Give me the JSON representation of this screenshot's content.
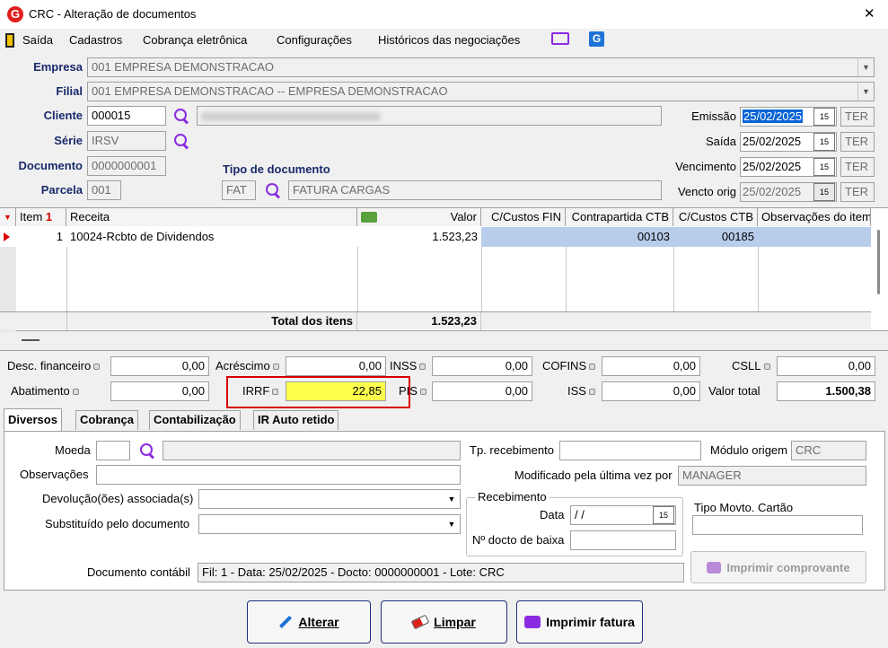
{
  "window": {
    "title": "CRC - Alteração de documentos",
    "close_label": "✕"
  },
  "menu": {
    "items": [
      "Saída",
      "Cadastros",
      "Cobrança eletrônica",
      "Configurações",
      "Históricos das negociações"
    ]
  },
  "header": {
    "empresa_label": "Empresa",
    "empresa_value": "001 EMPRESA DEMONSTRACAO",
    "filial_label": "Filial",
    "filial_value": "001 EMPRESA DEMONSTRACAO -- EMPRESA DEMONSTRACAO",
    "cliente_label": "Cliente",
    "cliente_value": "000015",
    "serie_label": "Série",
    "serie_value": "IRSV",
    "documento_label": "Documento",
    "documento_value": "0000000001",
    "parcela_label": "Parcela",
    "parcela_value": "001",
    "tipo_doc_label": "Tipo de documento",
    "tipo_doc_code": "FAT",
    "tipo_doc_desc": "FATURA CARGAS",
    "emissao_label": "Emissão",
    "emissao_value": "25/02/2025",
    "emissao_tz": "TER",
    "saida_label": "Saída",
    "saida_value": "25/02/2025",
    "saida_tz": "TER",
    "vencimento_label": "Vencimento",
    "vencimento_value": "25/02/2025",
    "vencimento_tz": "TER",
    "vencto_orig_label": "Vencto orig",
    "vencto_orig_value": "25/02/2025",
    "vencto_orig_tz": "TER",
    "cal_glyph": "15"
  },
  "grid": {
    "columns": [
      "Item",
      "Receita",
      "Valor",
      "C/Custos FIN",
      "Contrapartida CTB",
      "C/Custos CTB",
      "Observações do item"
    ],
    "sort_marker": "1",
    "rows": [
      {
        "item": "1",
        "receita": "10024-Rcbto de Dividendos",
        "valor": "1.523,23",
        "ccfin": "",
        "contrapartida": "00103",
        "ccctb": "00185",
        "obs": ""
      }
    ],
    "total_label": "Total dos itens",
    "total_value": "1.523,23"
  },
  "totals": {
    "desc_fin_label": "Desc. financeiro",
    "desc_fin": "0,00",
    "acrescimo_label": "Acréscimo",
    "acrescimo": "0,00",
    "inss_label": "INSS",
    "inss": "0,00",
    "cofins_label": "COFINS",
    "cofins": "0,00",
    "csll_label": "CSLL",
    "csll": "0,00",
    "abatimento_label": "Abatimento",
    "abatimento": "0,00",
    "irrf_label": "IRRF",
    "irrf": "22,85",
    "pis_label": "PIS",
    "pis": "0,00",
    "iss_label": "ISS",
    "iss": "0,00",
    "valor_total_label": "Valor total",
    "valor_total": "1.500,38"
  },
  "tabs": [
    "Diversos",
    "Cobrança",
    "Contabilização",
    "IR Auto retido"
  ],
  "diversos": {
    "moeda_label": "Moeda",
    "moeda_value": "",
    "obs_label": "Observações",
    "devol_label": "Devolução(ões) associada(s)",
    "subst_label": "Substituído pelo documento",
    "tp_receb_label": "Tp. recebimento",
    "modulo_label": "Módulo origem",
    "modulo_value": "CRC",
    "modificado_label": "Modificado pela última vez por",
    "modificado_value": "MANAGER",
    "recebimento_group": "Recebimento",
    "data_label": "Data",
    "data_value": " /  /",
    "docto_baixa_label": "Nº docto de baixa",
    "tipo_movto_label": "Tipo Movto. Cartão",
    "imprimir_comp_label": "Imprimir comprovante",
    "doc_contabil_label": "Documento contábil",
    "doc_contabil_value": "Fil: 1 - Data: 25/02/2025 - Docto: 0000000001 - Lote: CRC"
  },
  "buttons": {
    "alterar": "Alterar",
    "limpar": "Limpar",
    "imprimir_fatura": "Imprimir fatura"
  },
  "colors": {
    "accent": "#1a2a6c",
    "highlight": "#ffff4d",
    "highlight_border": "#d60000",
    "selection": "#b8cdec",
    "icon_purple": "#8a2be2",
    "logo_red": "#e0201c"
  }
}
